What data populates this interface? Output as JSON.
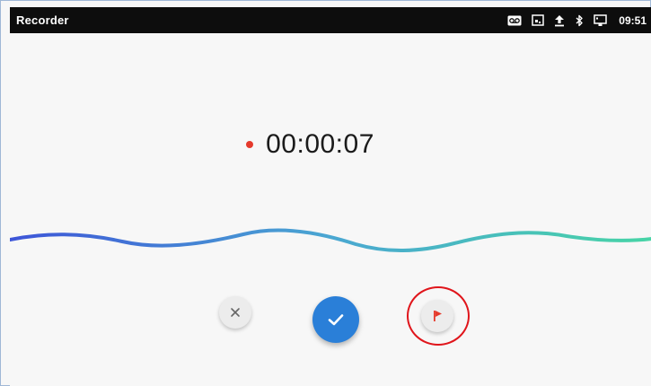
{
  "status_bar": {
    "app_title": "Recorder",
    "time": "09:51",
    "icons": [
      "voicemail-icon",
      "screenshot-icon",
      "upload-icon",
      "bluetooth-icon",
      "ethernet-icon"
    ]
  },
  "recording": {
    "elapsed": "00:00:07",
    "indicator_color": "#e53a2c"
  },
  "controls": {
    "cancel_icon": "close-icon",
    "save_icon": "checkmark-icon",
    "flag_icon": "flag-icon",
    "save_color": "#2a7fd8",
    "flag_color": "#e53a2c"
  },
  "annotation": {
    "highlight_color": "#e0151b"
  },
  "waveform": {
    "gradient": [
      "#3d55d8",
      "#4aa7d2",
      "#47d4a6"
    ]
  }
}
